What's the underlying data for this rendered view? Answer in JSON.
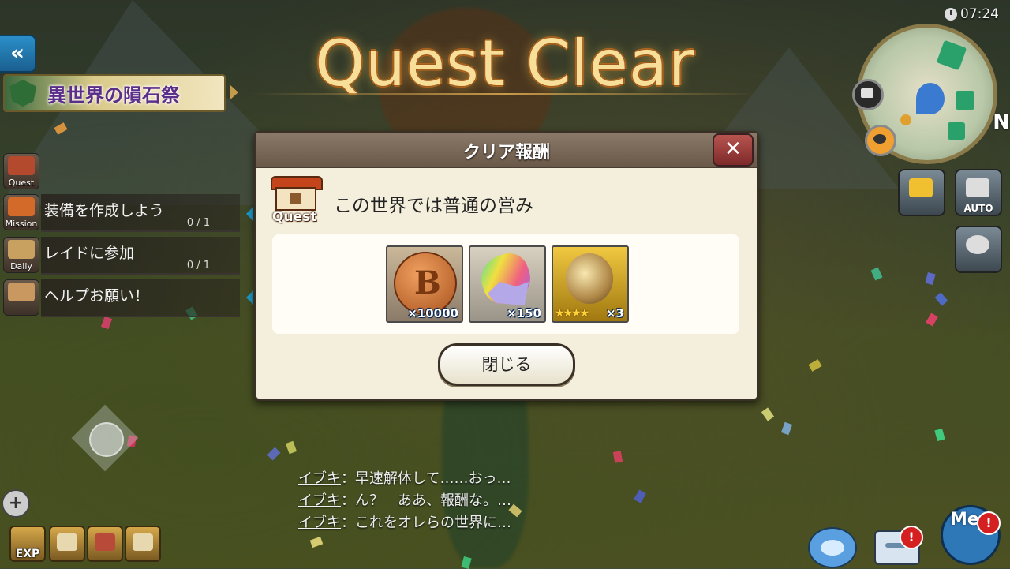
{
  "clock": {
    "time": "07:24"
  },
  "nav": {
    "back_glyph": "«"
  },
  "event_banner": {
    "title": "異世界の隕石祭",
    "icon": "emblem-icon"
  },
  "missions": [
    {
      "category": "Quest",
      "icon": "shop-icon"
    },
    {
      "category": "Mission",
      "title": "装備を作成しよう",
      "count": "0 / 1",
      "icon": "hammer-icon"
    },
    {
      "category": "Daily",
      "title": "レイドに参加",
      "count": "0 / 1",
      "icon": "scroll-icon"
    },
    {
      "category": "",
      "title": "ヘルプお願い！",
      "icon": "handshake-icon"
    }
  ],
  "overlay_title": "Quest Clear",
  "dialog": {
    "title": "クリア報酬",
    "close_glyph": "✕",
    "quest_label": "Quest",
    "quest_name": "この世界では普通の営み",
    "rewards": [
      {
        "name": "bronze-coin",
        "count": "×10000",
        "color": "#c8783a"
      },
      {
        "name": "rainbow-crystal",
        "count": "×150",
        "color": "#b4b4c8"
      },
      {
        "name": "gold-material",
        "count": "×3",
        "stars": "★★★★",
        "color": "#c99a28"
      }
    ],
    "close_button": "閉じる"
  },
  "minimap": {
    "compass": "N"
  },
  "right_buttons": [
    {
      "name": "camera",
      "label": ""
    },
    {
      "name": "auto",
      "label": "AUTO"
    },
    {
      "name": "party",
      "label": ""
    }
  ],
  "chat": [
    {
      "speaker": "イブキ",
      "text": "：早速解体して……おっ…"
    },
    {
      "speaker": "イブキ",
      "text": "：ん？　ああ、報酬な。…"
    },
    {
      "speaker": "イブキ",
      "text": "：これをオレらの世界に…"
    }
  ],
  "bottom_left": [
    {
      "name": "exp",
      "label": "EXP"
    },
    {
      "name": "shield",
      "label": ""
    },
    {
      "name": "boots",
      "label": ""
    },
    {
      "name": "gauntlet",
      "label": ""
    }
  ],
  "bottom_right": {
    "stamp_label": "",
    "chat_badge": "!",
    "me_label": "Me",
    "me_badge": "!"
  }
}
